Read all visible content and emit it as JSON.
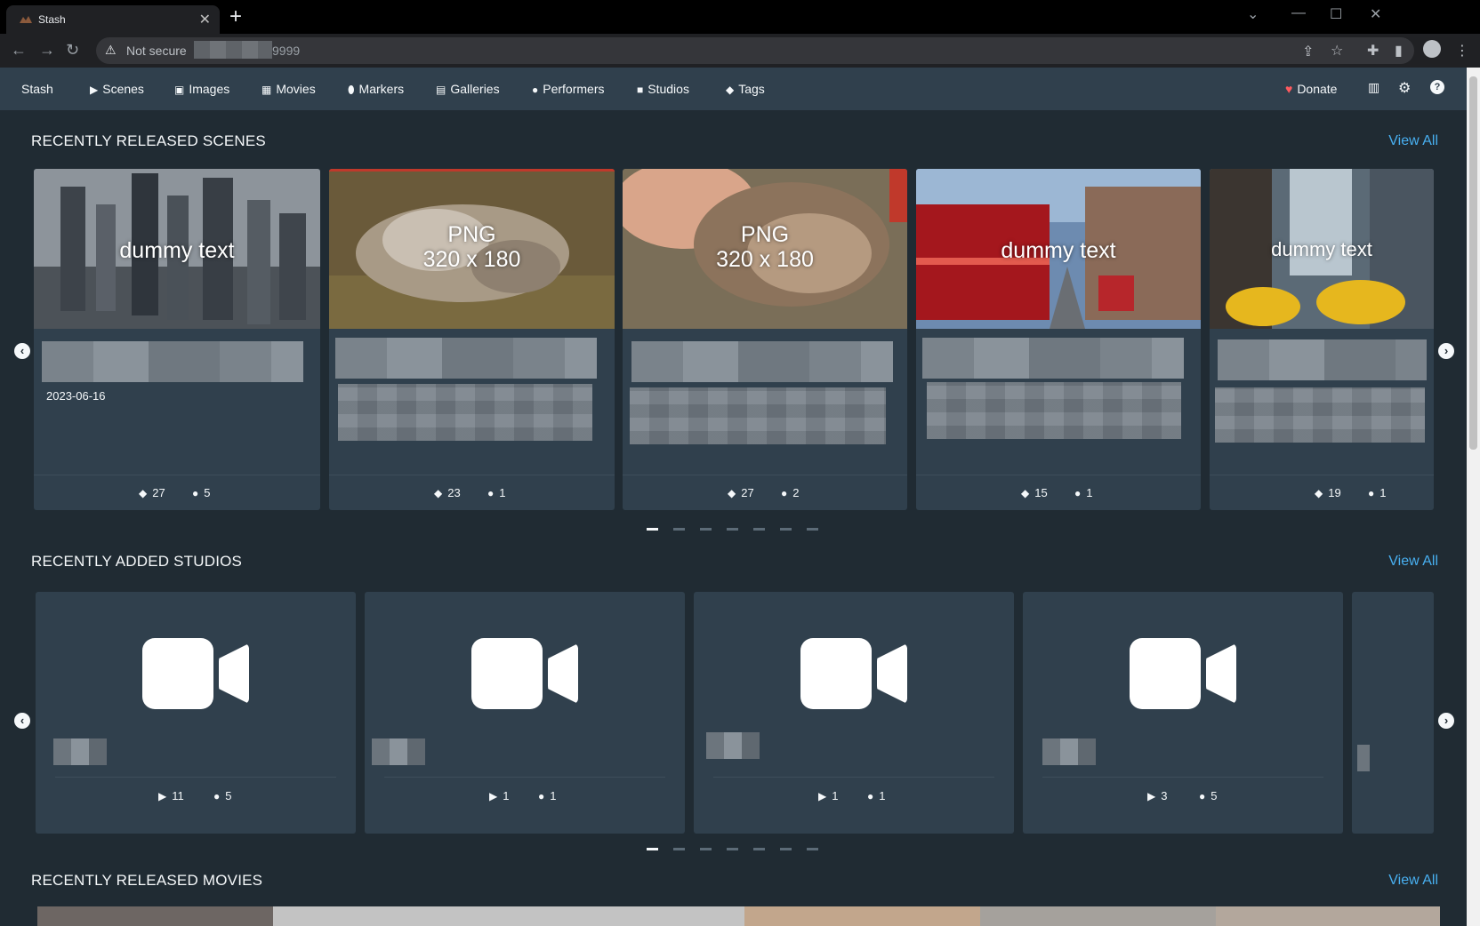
{
  "browser": {
    "tab_title": "Stash",
    "tab_close": "✕",
    "new_tab": "+",
    "security_label": "Not secure",
    "url_port": "9999"
  },
  "navbar": {
    "brand": "Stash",
    "links": [
      {
        "label": "Scenes",
        "icon": "play-circle-icon"
      },
      {
        "label": "Images",
        "icon": "image-icon"
      },
      {
        "label": "Movies",
        "icon": "film-icon"
      },
      {
        "label": "Markers",
        "icon": "map-marker-icon"
      },
      {
        "label": "Galleries",
        "icon": "images-icon"
      },
      {
        "label": "Performers",
        "icon": "user-icon"
      },
      {
        "label": "Studios",
        "icon": "video-icon"
      },
      {
        "label": "Tags",
        "icon": "tag-icon"
      }
    ],
    "donate": "Donate"
  },
  "sections": {
    "scenes": {
      "title": "RECENTLY RELEASED SCENES",
      "view_all": "View All",
      "cards": [
        {
          "overlay": "dummy text",
          "date": "2023-06-16",
          "tags": "27",
          "performers": "5"
        },
        {
          "overlay": "PNG",
          "overlay2": "320 x 180",
          "tags": "23",
          "performers": "1"
        },
        {
          "overlay": "PNG",
          "overlay2": "320 x 180",
          "tags": "27",
          "performers": "2"
        },
        {
          "overlay": "dummy text",
          "tags": "15",
          "performers": "1"
        },
        {
          "overlay": "dummy text",
          "tags": "19",
          "performers": "1"
        }
      ]
    },
    "studios": {
      "title": "RECENTLY ADDED STUDIOS",
      "view_all": "View All",
      "cards": [
        {
          "scenes": "11",
          "performers": "5"
        },
        {
          "scenes": "1",
          "performers": "1"
        },
        {
          "scenes": "1",
          "performers": "1"
        },
        {
          "scenes": "3",
          "performers": "5"
        }
      ]
    },
    "movies": {
      "title": "RECENTLY RELEASED MOVIES",
      "view_all": "View All"
    }
  },
  "colors": {
    "accent": "#48aff0",
    "navbar": "#30404d",
    "background": "#202b33",
    "donate_heart": "#ff5a5f"
  }
}
